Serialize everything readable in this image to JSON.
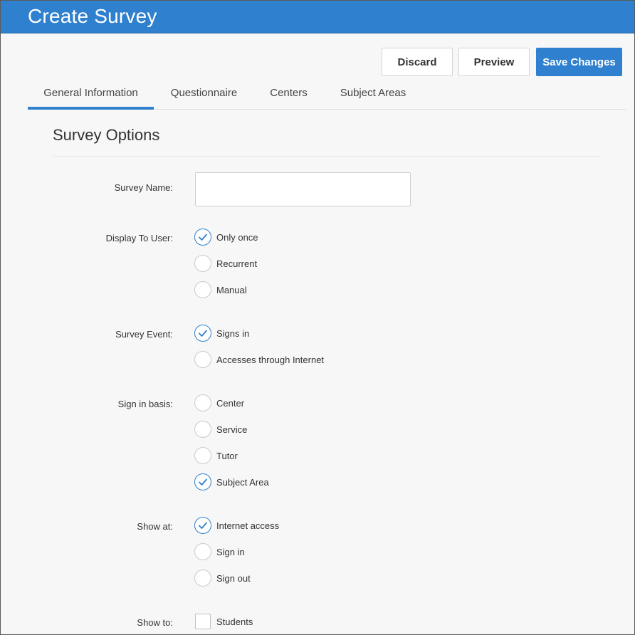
{
  "window": {
    "title": "Create Survey"
  },
  "toolbar": {
    "discard_label": "Discard",
    "preview_label": "Preview",
    "save_label": "Save Changes"
  },
  "tabs": [
    {
      "label": "General Information",
      "active": true
    },
    {
      "label": "Questionnaire",
      "active": false
    },
    {
      "label": "Centers",
      "active": false
    },
    {
      "label": "Subject Areas",
      "active": false
    }
  ],
  "section": {
    "title": "Survey Options"
  },
  "form": {
    "survey_name": {
      "label": "Survey Name:",
      "value": "",
      "placeholder": ""
    },
    "display_to_user": {
      "label": "Display To User:",
      "options": [
        {
          "label": "Only once",
          "checked": true
        },
        {
          "label": "Recurrent",
          "checked": false
        },
        {
          "label": "Manual",
          "checked": false
        }
      ]
    },
    "survey_event": {
      "label": "Survey Event:",
      "options": [
        {
          "label": "Signs in",
          "checked": true
        },
        {
          "label": "Accesses through Internet",
          "checked": false
        }
      ]
    },
    "sign_in_basis": {
      "label": "Sign in basis:",
      "options": [
        {
          "label": "Center",
          "checked": false
        },
        {
          "label": "Service",
          "checked": false
        },
        {
          "label": "Tutor",
          "checked": false
        },
        {
          "label": "Subject Area",
          "checked": true
        }
      ]
    },
    "show_at": {
      "label": "Show at:",
      "options": [
        {
          "label": "Internet access",
          "checked": true
        },
        {
          "label": "Sign in",
          "checked": false
        },
        {
          "label": "Sign out",
          "checked": false
        }
      ]
    },
    "show_to": {
      "label": "Show to:",
      "options": [
        {
          "label": "Students",
          "checked": false
        }
      ]
    }
  },
  "colors": {
    "accent": "#2f80ce",
    "background": "#f7f7f7",
    "border": "#d4d4d4"
  },
  "icons": {
    "radio_checked": "checkmark-icon"
  }
}
